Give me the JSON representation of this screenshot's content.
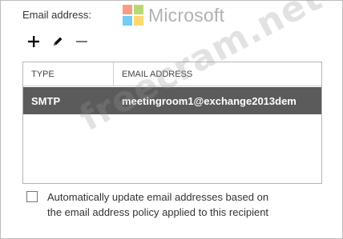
{
  "field_label": "Email address:",
  "logo": {
    "text": "Microsoft",
    "colors": [
      "#f25022",
      "#7fba00",
      "#00a4ef",
      "#ffb900"
    ]
  },
  "toolbar": {
    "add_icon": "plus-icon",
    "edit_icon": "pencil-icon",
    "remove_icon": "minus-icon"
  },
  "table": {
    "columns": [
      "TYPE",
      "EMAIL ADDRESS"
    ],
    "rows": [
      {
        "type": "SMTP",
        "email": "meetingroom1@exchange2013dem",
        "selected": true
      }
    ]
  },
  "watermark": "freecram.net",
  "checkbox": {
    "checked": false,
    "line1": "Automatically update email addresses based on",
    "line2": "the email address policy applied to this recipient"
  },
  "colors": {
    "selected_row": "#5b5b5b",
    "border": "#b5b5b5"
  }
}
